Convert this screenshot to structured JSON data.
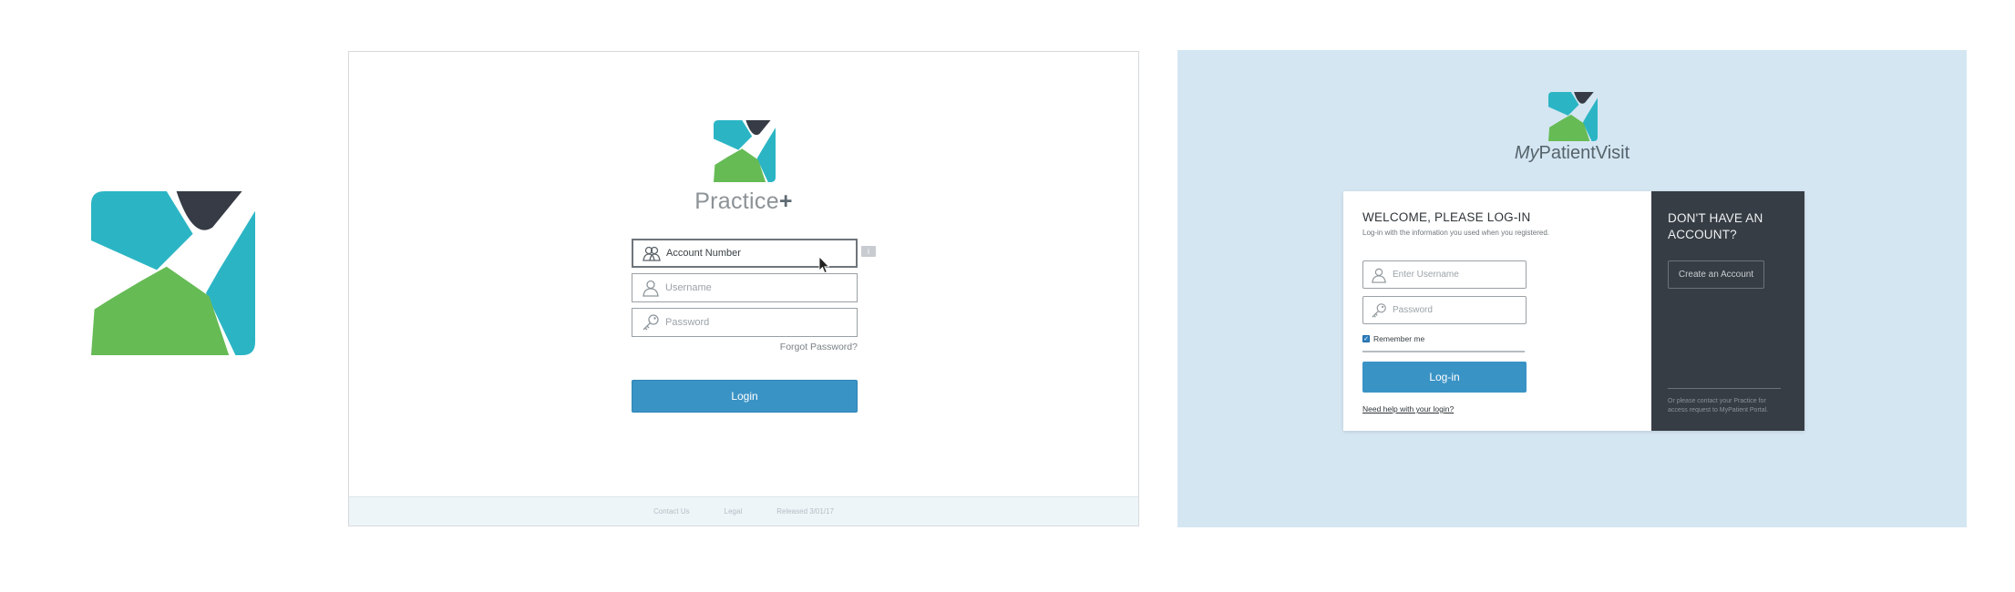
{
  "colors": {
    "logo_teal": "#2bb5c4",
    "logo_green": "#66bb55",
    "logo_dark": "#363b45",
    "primary_button": "#3a93c5",
    "mpv_background": "#d4e6f2",
    "mpv_dark_panel": "#373d44"
  },
  "practice": {
    "brand_name": "Practice",
    "brand_plus": "+",
    "account_placeholder": "Account Number",
    "username_placeholder": "Username",
    "password_placeholder": "Password",
    "info_label": "i",
    "forgot_password": "Forgot Password?",
    "login_button": "Login",
    "footer": {
      "contact": "Contact Us",
      "legal": "Legal",
      "released": "Released 3/01/17"
    },
    "icons": {
      "account": "people-icon",
      "username": "user-icon",
      "password": "key-icon"
    }
  },
  "mypatientvisit": {
    "brand_my": "My",
    "brand_rest": "PatientVisit",
    "welcome_title": "WELCOME, PLEASE LOG-IN",
    "welcome_subtitle": "Log-in with the information you used when you registered.",
    "username_placeholder": "Enter Username",
    "password_placeholder": "Password",
    "remember_me": "Remember me",
    "remember_checked": true,
    "login_button": "Log-in",
    "help_link": "Need help with your login?",
    "no_account_title": "DON'T HAVE AN ACCOUNT?",
    "create_account_button": "Create an Account",
    "contact_note": "Or please contact your Practice for access request to MyPatient Portal.",
    "icons": {
      "username": "user-icon",
      "password": "key-icon"
    }
  }
}
